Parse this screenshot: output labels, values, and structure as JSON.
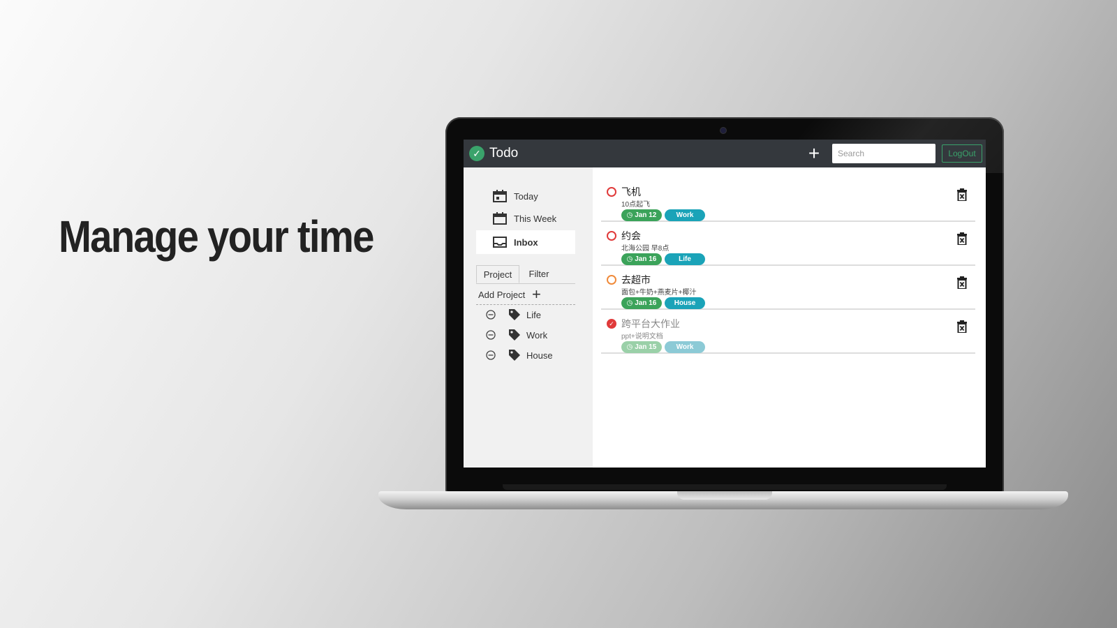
{
  "headline": "Manage your time",
  "app": {
    "title": "Todo",
    "add_label": "+",
    "search_placeholder": "Search",
    "logout_label": "LogOut"
  },
  "sidebar": {
    "nav": [
      {
        "label": "Today",
        "icon": "calendar-day-icon"
      },
      {
        "label": "This Week",
        "icon": "calendar-week-icon"
      },
      {
        "label": "Inbox",
        "icon": "inbox-icon",
        "active": true
      }
    ],
    "tabs": [
      "Project",
      "Filter"
    ],
    "add_project_label": "Add Project",
    "projects": [
      "Life",
      "Work",
      "House"
    ]
  },
  "tasks": [
    {
      "title": "飞机",
      "desc": "10点起飞",
      "date": "Jan 12",
      "project": "Work",
      "status": "open"
    },
    {
      "title": "约会",
      "desc": "北海公园 早8点",
      "date": "Jan 16",
      "project": "Life",
      "status": "open"
    },
    {
      "title": "去超市",
      "desc": "面包+牛奶+燕麦片+椰汁",
      "date": "Jan 16",
      "project": "House",
      "status": "open"
    },
    {
      "title": "跨平台大作业",
      "desc": "ppt+说明文档",
      "date": "Jan 15",
      "project": "Work",
      "status": "done"
    }
  ],
  "colors": {
    "accent": "#3aa36b",
    "topbar": "#34383d",
    "date_badge": "#3ba35a",
    "project_badge": "#1aa3b8",
    "priority_red": "#e03a3a",
    "priority_orange": "#f08a3a"
  }
}
